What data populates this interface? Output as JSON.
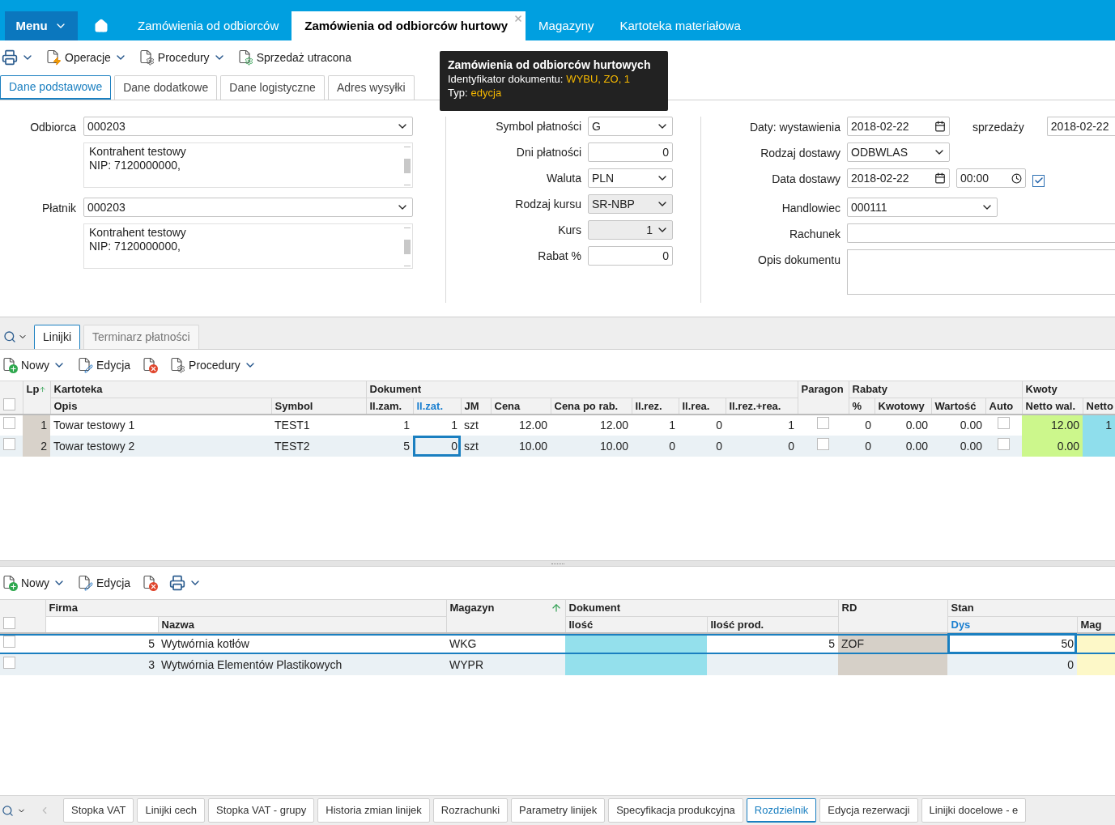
{
  "top_bar": {
    "menu": {
      "label": "Menu"
    },
    "tabs": [
      {
        "label": "Zamówienia od odbiorców",
        "selected": false
      },
      {
        "label": "Zamówienia od odbiorców hurtowy",
        "selected": true
      },
      {
        "label": "Magazyny",
        "selected": false
      },
      {
        "label": "Kartoteka materiałowa",
        "selected": false
      }
    ]
  },
  "toolbar": [
    {
      "kind": "print",
      "dropdown": true
    },
    {
      "kind": "operations",
      "label": "Operacje",
      "dropdown": true
    },
    {
      "kind": "procedures",
      "label": "Procedury",
      "dropdown": true
    },
    {
      "kind": "lost_sale",
      "label": "Sprzedaż utracona",
      "dropdown": false
    }
  ],
  "form_tabs": [
    {
      "label": "Dane podstawowe",
      "selected": true
    },
    {
      "label": "Dane dodatkowe",
      "selected": false
    },
    {
      "label": "Dane logistyczne",
      "selected": false
    },
    {
      "label": "Adres wysyłki",
      "selected": false
    }
  ],
  "tooltip": {
    "title": "Zamówienia od odbiorców hurtowych",
    "lines": [
      {
        "label": "Identyfikator dokumentu:",
        "value": "WYBU, ZO, 1"
      },
      {
        "label": "Typ:",
        "value": "edycja"
      }
    ]
  },
  "parties": [
    {
      "label": "Odbiorca",
      "value": "000203",
      "details": [
        "Kontrahent testowy",
        "NIP: 7120000000,"
      ]
    },
    {
      "label": "Płatnik",
      "value": "000203",
      "details": [
        "Kontrahent testowy",
        "NIP: 7120000000,"
      ]
    }
  ],
  "payment": [
    {
      "label": "Symbol płatności",
      "kind": "select",
      "value": "G",
      "disabled": false
    },
    {
      "label": "Dni płatności",
      "kind": "number",
      "value": "0",
      "disabled": false
    },
    {
      "label": "Waluta",
      "kind": "select",
      "value": "PLN",
      "disabled": false
    },
    {
      "label": "Rodzaj kursu",
      "kind": "select",
      "value": "SR-NBP",
      "disabled": true
    },
    {
      "label": "Kurs",
      "kind": "number_select",
      "value": "1",
      "disabled": true
    },
    {
      "label": "Rabat %",
      "kind": "number",
      "value": "0",
      "disabled": false
    }
  ],
  "details": [
    {
      "label": "Daty: wystawienia",
      "fields": [
        {
          "kind": "date",
          "value": "2018-02-22"
        },
        {
          "kind": "label",
          "text": "sprzedaży"
        },
        {
          "kind": "text",
          "value": "2018-02-22"
        }
      ]
    },
    {
      "label": "Rodzaj dostawy",
      "fields": [
        {
          "kind": "select",
          "value": "ODBWLAS"
        }
      ]
    },
    {
      "label": "Data dostawy",
      "fields": [
        {
          "kind": "date",
          "value": "2018-02-22"
        },
        {
          "kind": "time",
          "value": "00:00"
        },
        {
          "kind": "checkbox",
          "checked": true
        }
      ]
    },
    {
      "label": "Handlowiec",
      "fields": [
        {
          "kind": "select",
          "value": "000111"
        }
      ]
    },
    {
      "label": "Rachunek",
      "fields": [
        {
          "kind": "text"
        }
      ]
    },
    {
      "label": "Opis dokumentu",
      "fields": [
        {
          "kind": "textarea"
        }
      ]
    }
  ],
  "lines_section": {
    "tabs": [
      {
        "label": "Linijki",
        "selected": true
      },
      {
        "label": "Terminarz płatności",
        "selected": false
      }
    ],
    "toolbar": [
      {
        "kind": "new",
        "label": "Nowy",
        "dropdown": true
      },
      {
        "kind": "edit",
        "label": "Edycja",
        "dropdown": false
      },
      {
        "kind": "delete",
        "dropdown": false
      },
      {
        "kind": "procedures",
        "label": "Procedury",
        "dropdown": true
      }
    ],
    "table": {
      "active": false,
      "header": [
        {
          "kind": "checkbox",
          "checked": false
        },
        {
          "label": "Lp",
          "kind": "number",
          "sorted": true,
          "color": "#d8d2ca"
        },
        {
          "label": "Kartoteka",
          "columns": [
            {
              "label": "Opis",
              "kind": "text"
            },
            {
              "label": "Symbol",
              "kind": "text"
            }
          ]
        },
        {
          "label": "Dokument",
          "columns": [
            {
              "label": "Il.zam.",
              "kind": "number"
            },
            {
              "label": "Il.zat.",
              "kind": "number",
              "focused": true
            },
            {
              "label": "JM",
              "kind": "text"
            },
            {
              "label": "Cena",
              "kind": "number"
            },
            {
              "label": "Cena po rab.",
              "kind": "number"
            },
            {
              "label": "Il.rez.",
              "kind": "number"
            },
            {
              "label": "Il.rea.",
              "kind": "number"
            },
            {
              "label": "Il.rez.+rea.",
              "kind": "number"
            }
          ]
        },
        {
          "label": "Paragon",
          "kind": "checkbox"
        },
        {
          "label": "Rabaty",
          "columns": [
            {
              "label": "%",
              "kind": "number"
            },
            {
              "label": "Kwotowy",
              "kind": "number"
            },
            {
              "label": "Wartość",
              "kind": "number"
            },
            {
              "label": "Auto",
              "kind": "checkbox"
            }
          ]
        },
        {
          "label": "Kwoty",
          "columns": [
            {
              "label": "Netto wal.",
              "kind": "number",
              "color": "#ccf78c"
            },
            {
              "label": "Netto",
              "kind": "number",
              "color": "#8fdeec"
            }
          ]
        }
      ],
      "rows": [
        {
          "selected": false,
          "cells": [
            false,
            "1",
            "Towar testowy 1",
            "TEST1",
            "1",
            "1",
            "szt",
            "12.00",
            "12.00",
            "1",
            "0",
            "1",
            false,
            "0",
            "0.00",
            "0.00",
            false,
            "12.00",
            "1"
          ]
        },
        {
          "selected": true,
          "cells": [
            false,
            "2",
            "Towar testowy 2",
            "TEST2",
            "5",
            "0",
            "szt",
            "10.00",
            "10.00",
            "0",
            "0",
            "0",
            false,
            "0",
            "0.00",
            "0.00",
            false,
            "0.00",
            null
          ]
        }
      ]
    }
  },
  "distribution_section": {
    "toolbar": [
      {
        "kind": "new",
        "label": "Nowy",
        "dropdown": true
      },
      {
        "kind": "edit",
        "label": "Edycja",
        "dropdown": false
      },
      {
        "kind": "delete",
        "dropdown": false
      },
      {
        "kind": "print",
        "dropdown": true
      }
    ],
    "table": {
      "active": true,
      "header": [
        {
          "kind": "checkbox",
          "checked": false
        },
        {
          "label": "Firma",
          "columns": [
            {
              "kind": "number"
            },
            {
              "label": "Nazwa",
              "kind": "text"
            }
          ]
        },
        {
          "label": "Magazyn",
          "kind": "text",
          "sorted": true
        },
        {
          "label": "Dokument",
          "columns": [
            {
              "label": "Ilość",
              "kind": "number",
              "color": "#94e0ec"
            },
            {
              "label": "Ilość prod.",
              "kind": "number"
            }
          ]
        },
        {
          "label": "RD",
          "kind": "text",
          "color": "#d6d0c8"
        },
        {
          "label": "Stan",
          "columns": [
            {
              "label": "Dys",
              "kind": "number",
              "focused": true
            },
            {
              "label": "Mag",
              "kind": "number",
              "color": "#fdf8c8"
            }
          ]
        }
      ],
      "rows": [
        {
          "selected": true,
          "cells": [
            false,
            "5",
            "Wytwórnia kotłów",
            "WKG",
            null,
            "5",
            "ZOF",
            "50",
            null
          ]
        },
        {
          "selected": false,
          "cells": [
            false,
            "3",
            "Wytwórnia Elementów Plastikowych",
            "WYPR",
            null,
            null,
            null,
            "0",
            null
          ]
        }
      ]
    }
  },
  "bottom_tabs": [
    {
      "label": "Stopka VAT",
      "selected": false
    },
    {
      "label": "Linijki cech",
      "selected": false
    },
    {
      "label": "Stopka VAT - grupy",
      "selected": false
    },
    {
      "label": "Historia zmian linijek",
      "selected": false
    },
    {
      "label": "Rozrachunki",
      "selected": false
    },
    {
      "label": "Parametry linijek",
      "selected": false
    },
    {
      "label": "Specyfikacja produkcyjna",
      "selected": false
    },
    {
      "label": "Rozdzielnik",
      "selected": true
    },
    {
      "label": "Edycja rezerwacji",
      "selected": false
    },
    {
      "label": "Linijki docelowe - e",
      "selected": false
    }
  ]
}
